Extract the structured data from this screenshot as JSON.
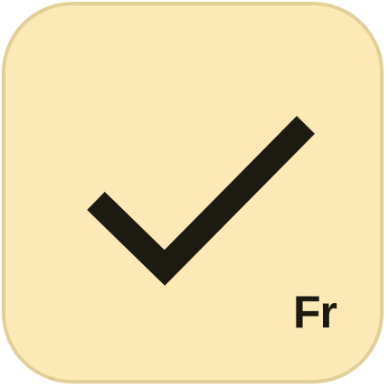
{
  "icon": {
    "symbol": "checkmark-icon",
    "badge_text": "Fr",
    "background_color": "#fde9b5",
    "border_color": "#e2cf98",
    "glyph_color": "#1d1a12"
  }
}
